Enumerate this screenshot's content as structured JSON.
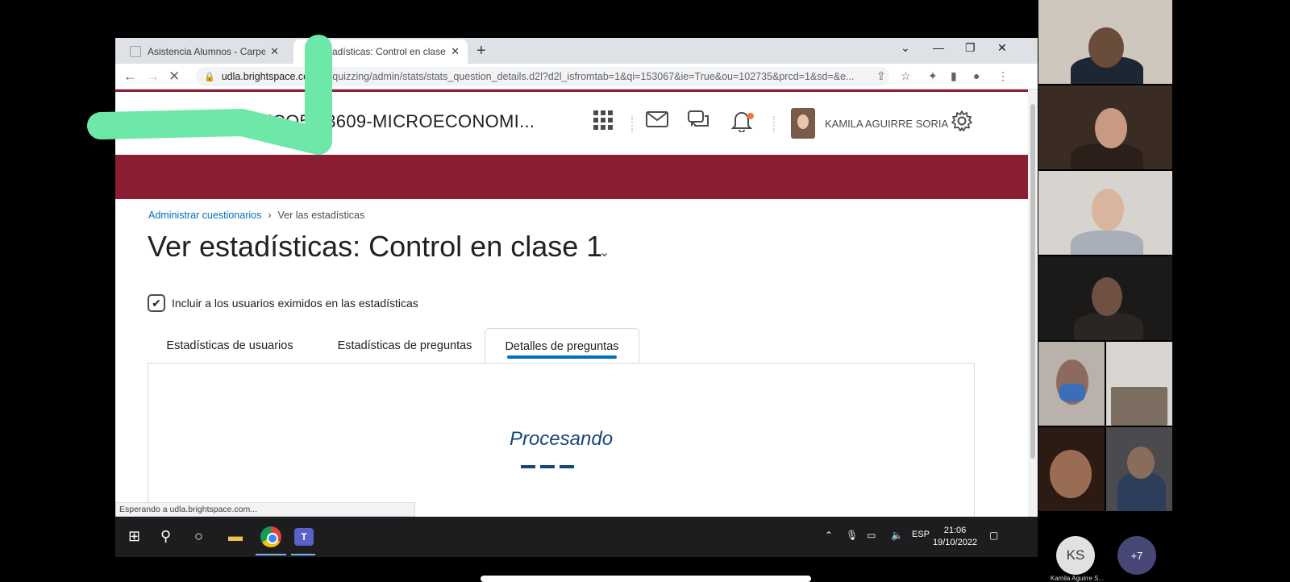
{
  "browser": {
    "tabs": [
      {
        "title": "Asistencia Alumnos - CarpetaEnL",
        "active": false
      },
      {
        "title": "estadísticas: Control en clase",
        "active": true
      }
    ],
    "url": "udla.brightspace.co...l/lms/quizzing/admin/stats/stats_question_details.d2l?d2l_isfromtab=1&qi=153067&ie=True&ou=102735&prcd=1&sd=&e...",
    "url_display": "udla.brightspace.co",
    "url_path": "l/lms/quizzing/admin/stats/stats_question_details.d2l?d2l_isfromtab=1&qi=153067&ie=True&ou=102735&prcd=1&sd=&e...",
    "status_text": "Esperando a udla.brightspace.com..."
  },
  "header": {
    "course_title_visible": "ECO",
    "course_title_rest": "54-3609-MICROECONOMI...",
    "user_name": "KAMILA AGUIRRE SORIA",
    "accent_color": "#8b1f31"
  },
  "breadcrumb": {
    "parent": "Administrar cuestionarios",
    "separator": "›",
    "current": "Ver las estadísticas"
  },
  "page": {
    "title": "Ver estadísticas: Control en clase 1",
    "checkbox_label": "Incluir a los usuarios eximidos en las estadísticas",
    "checkbox_checked": true,
    "tabs": [
      {
        "label": "Estadísticas de usuarios",
        "selected": false
      },
      {
        "label": "Estadísticas de preguntas",
        "selected": false
      },
      {
        "label": "Detalles de preguntas",
        "selected": true
      }
    ],
    "processing_text": "Procesando"
  },
  "taskbar": {
    "language": "ESP",
    "time": "21:06",
    "date": "19/10/2022"
  },
  "meeting": {
    "self_initials": "KS",
    "self_name": "Kamila Aguirre S...",
    "more_count": "+7"
  }
}
